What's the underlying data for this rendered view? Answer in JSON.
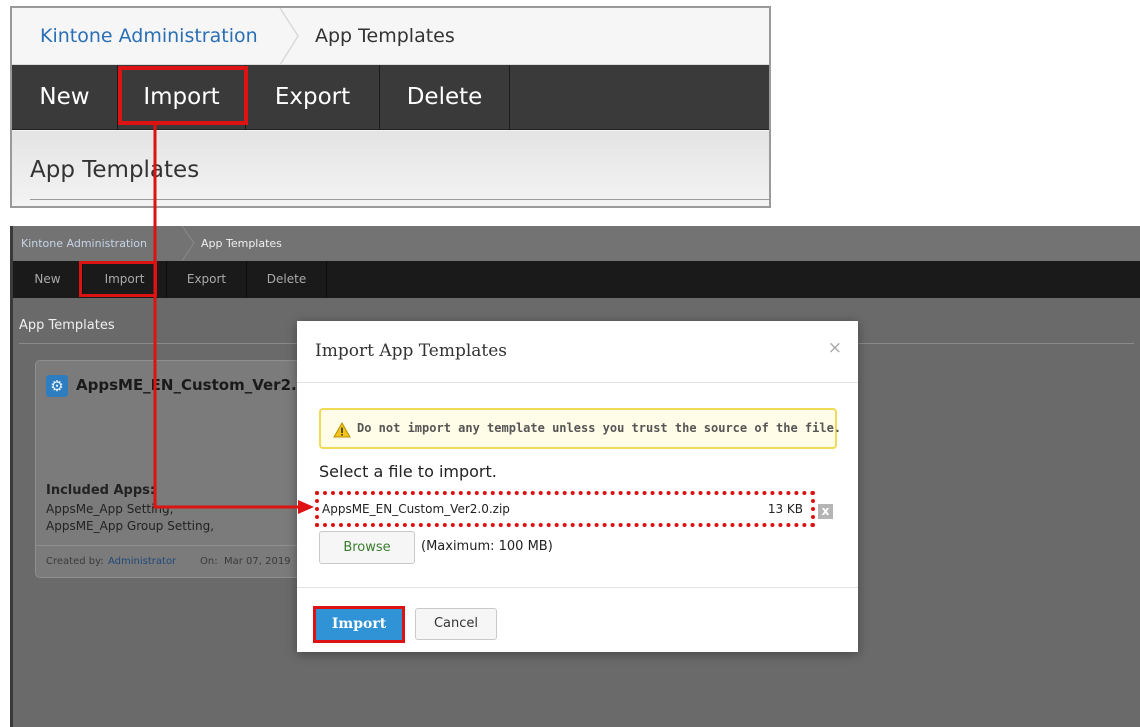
{
  "zoom_panel": {
    "breadcrumb": {
      "root": "Kintone Administration",
      "current": "App Templates"
    },
    "toolbar": {
      "new": "New",
      "import": "Import",
      "export": "Export",
      "delete": "Delete"
    },
    "heading": "App Templates"
  },
  "app": {
    "breadcrumb": {
      "root": "Kintone Administration",
      "current": "App Templates"
    },
    "toolbar": {
      "new": "New",
      "import": "Import",
      "export": "Export",
      "delete": "Delete"
    },
    "heading": "App Templates",
    "card": {
      "icon": "gear-icon",
      "name": "AppsME_EN_Custom_Ver2.",
      "included_label": "Included Apps:",
      "apps": [
        "AppsMe_App Setting,",
        "AppsME_App Group Setting,"
      ],
      "created_by_label": "Created by:",
      "created_by": "Administrator",
      "on_label": "On:",
      "on_date": "Mar 07, 2019"
    }
  },
  "dialog": {
    "title": "Import App Templates",
    "close": "×",
    "warning": "Do not import any template unless you trust the source of the file.",
    "select_label": "Select a file to import.",
    "file_name": "AppsME_EN_Custom_Ver2.0.zip",
    "file_size": "13 KB",
    "remove": "x",
    "browse": "Browse",
    "max": "(Maximum: 100 MB)",
    "import": "Import",
    "cancel": "Cancel"
  },
  "colors": {
    "annotation": "#dd1212",
    "link": "#2a6fb5",
    "primary_button": "#2f93d6",
    "warning_border": "#f0da56"
  }
}
